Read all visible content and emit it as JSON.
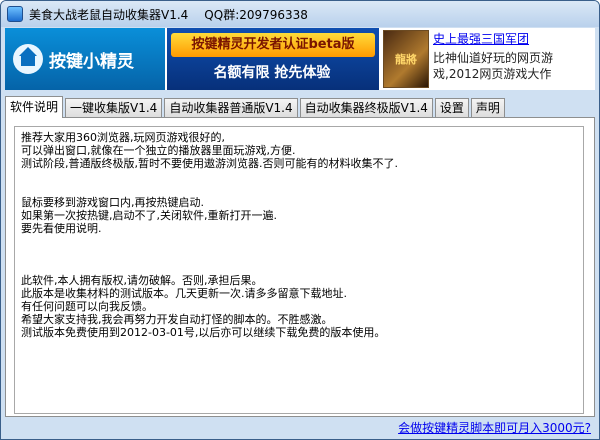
{
  "window": {
    "title": "美食大战老鼠自动收集器V1.4",
    "qq": "QQ群:209796338"
  },
  "banner": {
    "logo_text": "按键小精灵",
    "ad_line1": "按键精灵开发者认证beta版",
    "ad_line2": "名额有限 抢先体验",
    "game_thumb_text": "龍將",
    "game_link": "史上最强三国军团",
    "game_desc": "比神仙道好玩的网页游戏,2012网页游戏大作"
  },
  "tabs": [
    {
      "label": "软件说明",
      "active": true
    },
    {
      "label": "一键收集版V1.4",
      "active": false
    },
    {
      "label": "自动收集器普通版V1.4",
      "active": false
    },
    {
      "label": "自动收集器终极版V1.4",
      "active": false
    },
    {
      "label": "设置",
      "active": false
    },
    {
      "label": "声明",
      "active": false
    }
  ],
  "notes": {
    "text": "推荐大家用360浏览器,玩网页游戏很好的,\n可以弹出窗口,就像在一个独立的播放器里面玩游戏,方便.\n测试阶段,普通版终极版,暂时不要使用遨游浏览器.否则可能有的材料收集不了.\n\n\n鼠标要移到游戏窗口内,再按热键启动.\n如果第一次按热键,启动不了,关闭软件,重新打开一遍.\n要先看使用说明.\n\n\n\n此软件,本人拥有版权,请勿破解。否则,承担后果。\n此版本是收集材料的测试版本。几天更新一次.请多多留意下载地址.\n有任何问题可以向我反馈。\n希望大家支持我,我会再努力开发自动打怪的脚本的。不胜感激。\n测试版本免费使用到2012-03-01号,以后亦可以继续下载免费的版本使用。"
  },
  "footer": {
    "link": "会做按键精灵脚本即可月入3000元?"
  }
}
